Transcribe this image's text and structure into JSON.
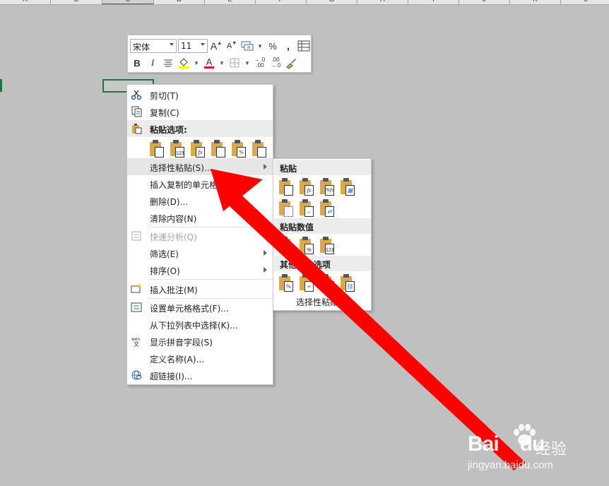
{
  "columns": [
    "A",
    "B",
    "C",
    "D",
    "E",
    "F",
    "G",
    "H",
    "I",
    "J",
    "K",
    "L"
  ],
  "mini_toolbar": {
    "font_name": "宋体",
    "font_size": "11",
    "grow_font": "A",
    "shrink_font": "A",
    "percent": "%",
    "comma": ",",
    "bold": "B",
    "italic": "I",
    "font_color_label": "A",
    "font_color": "#e81123",
    "inc_decimal": ".00",
    "dec_decimal": ".00"
  },
  "context_menu": {
    "cut": "剪切(T)",
    "copy": "复制(C)",
    "paste_options_header": "粘贴选项:",
    "paste_special": "选择性粘贴(S)...",
    "insert_copied_cells": "插入复制的单元格",
    "delete": "删除(D)...",
    "clear_contents": "清除内容(N)",
    "quick_analysis": "快速分析(Q)",
    "filter": "筛选(E)",
    "sort": "排序(O)",
    "insert_comment": "插入批注(M)",
    "format_cells": "设置单元格格式(F)...",
    "pick_from_list": "从下拉列表中选择(K)...",
    "show_phonetic": "显示拼音字段(S)",
    "define_name": "定义名称(A)...",
    "hyperlink": "超链接(I)...",
    "paste_icon_labels": [
      "",
      "123",
      "fx",
      "",
      "%",
      ""
    ]
  },
  "submenu": {
    "paste_header": "粘贴",
    "paste_values_header": "粘贴数值",
    "other_header": "其他粘贴选项",
    "paste_special_footer": "选择性粘贴(S)..."
  },
  "watermark": {
    "brand": "Bai",
    "brand_suffix": "du",
    "cn": "经验",
    "url": "jingyan.baidu.com"
  },
  "colors": {
    "accent_green": "#217346",
    "arrow_red": "#ff0000",
    "clipboard_gold": "#d9a94e"
  }
}
